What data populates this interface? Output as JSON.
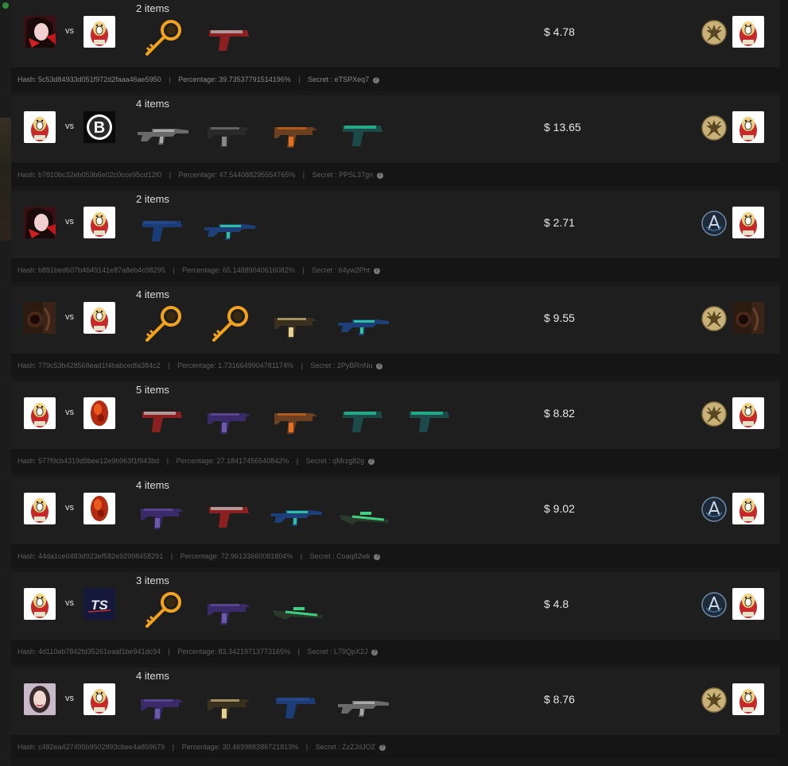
{
  "labels": {
    "vs": "vs",
    "hash": "Hash:",
    "percentage": "Percentage:",
    "secret": "Secret :",
    "sep": "|"
  },
  "colors": {
    "row_bg": "#1e1e1e",
    "footer_bg": "#151515",
    "key_gold": "#f2a31b",
    "rank_gold": "#c8b27a",
    "rank_blue": "#3c6d98"
  },
  "games": [
    {
      "items_label": "2 items",
      "player": "anime-girl-avatar",
      "opponent": "cartoon-avatar",
      "items": [
        "key",
        "pistol-red"
      ],
      "value": "$ 4.78",
      "winner_rank": "gold-star",
      "winner": "cartoon-avatar",
      "hash": "5c53d84933d051f972d2faaa46ae5950",
      "percentage": "39.73537791514196%",
      "secret": "eTSPXeq7"
    },
    {
      "items_label": "4 items",
      "player": "cartoon-avatar",
      "opponent": "b-logo-avatar",
      "items": [
        "rifle-gray",
        "smg-black",
        "smg-orange",
        "pistol-teal"
      ],
      "value": "$ 13.65",
      "winner_rank": "gold-star",
      "winner": "cartoon-avatar",
      "hash": "b7810bc32eb053b6e02c0cce95cd12f0",
      "percentage": "47.544088295554765%",
      "secret": "PPSL37gn"
    },
    {
      "items_label": "2 items",
      "player": "anime-girl-avatar",
      "opponent": "cartoon-avatar",
      "items": [
        "pistol-blue",
        "rifle-blue"
      ],
      "value": "$ 2.71",
      "winner_rank": "blue-emblem",
      "winner": "cartoon-avatar",
      "hash": "b891bed607b4649141e87a8eb4c08295",
      "percentage": "65.14889040616082%",
      "secret": "64yw2Pht"
    },
    {
      "items_label": "4 items",
      "player": "dark-avatar",
      "opponent": "cartoon-avatar",
      "items": [
        "key",
        "key",
        "smg-gold",
        "rifle-blue"
      ],
      "value": "$ 9.55",
      "winner_rank": "gold-star",
      "winner": "dark-avatar",
      "hash": "779c53b428568ead1f4babcedfa384c2",
      "percentage": "1.7316649904781174%",
      "secret": "2PyBRnNu"
    },
    {
      "items_label": "5 items",
      "player": "cartoon-avatar",
      "opponent": "red-orb-avatar",
      "items": [
        "pistol-red",
        "smg-purple",
        "smg-orange",
        "pistol-teal",
        "pistol-teal"
      ],
      "value": "$ 8.82",
      "winner_rank": "gold-star",
      "winner": "cartoon-avatar",
      "hash": "577f9cb4319d9bee12e9b963f1f943bd",
      "percentage": "27.18417456540842%",
      "secret": "qMrzg82g"
    },
    {
      "items_label": "4 items",
      "player": "cartoon-avatar",
      "opponent": "red-orb-avatar",
      "items": [
        "smg-purple",
        "pistol-red",
        "rifle-blue",
        "sniper-green"
      ],
      "value": "$ 9.02",
      "winner_rank": "blue-emblem",
      "winner": "cartoon-avatar",
      "hash": "44da1ce0483d923ef582e92998458291",
      "percentage": "72.96133660081804%",
      "secret": "Coaq82wk"
    },
    {
      "items_label": "3 items",
      "player": "cartoon-avatar",
      "opponent": "ts-logo-avatar",
      "items": [
        "key",
        "smg-purple",
        "sniper-green"
      ],
      "value": "$ 4.8",
      "winner_rank": "blue-emblem",
      "winner": "cartoon-avatar",
      "hash": "4d110ab7842fd35261eaaf1be941dc94",
      "percentage": "83.34219713773165%",
      "secret": "L79QpX2J"
    },
    {
      "items_label": "4 items",
      "player": "woman-photo-avatar",
      "opponent": "cartoon-avatar",
      "items": [
        "smg-purple",
        "smg-gold",
        "pistol-blue",
        "rifle-gray"
      ],
      "value": "$ 8.76",
      "winner_rank": "gold-star",
      "winner": "cartoon-avatar",
      "hash": "c482ea427495b9502893cbee4a859679",
      "percentage": "30.469988386721813%",
      "secret": "ZzZJdJOZ"
    }
  ]
}
